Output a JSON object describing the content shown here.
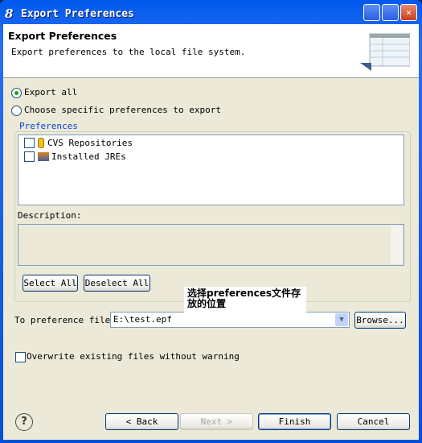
{
  "window": {
    "title": "Export Preferences",
    "app_icon": "eclipse-icon"
  },
  "header": {
    "title": "Export Preferences",
    "description": "Export preferences to the local file system."
  },
  "options": {
    "export_all": "Export all",
    "choose_specific": "Choose specific preferences to export",
    "selected": "export_all"
  },
  "preferences": {
    "label": "Preferences",
    "items": [
      {
        "label": "CVS Repositories",
        "checked": false,
        "icon": "cylinder-icon"
      },
      {
        "label": "Installed JREs",
        "checked": false,
        "icon": "jre-icon"
      }
    ]
  },
  "description": {
    "label": "Description:"
  },
  "buttons": {
    "select_all": "Select All",
    "deselect_all": "Deselect All",
    "browse": "Browse...",
    "back": "< Back",
    "next": "Next >",
    "finish": "Finish",
    "cancel": "Cancel"
  },
  "file": {
    "label": "To preference file:",
    "value": "E:\\test.epf"
  },
  "overwrite": {
    "label": "Overwrite existing files without warning",
    "checked": false
  },
  "annotation": "选择preferences文件存放的位置"
}
